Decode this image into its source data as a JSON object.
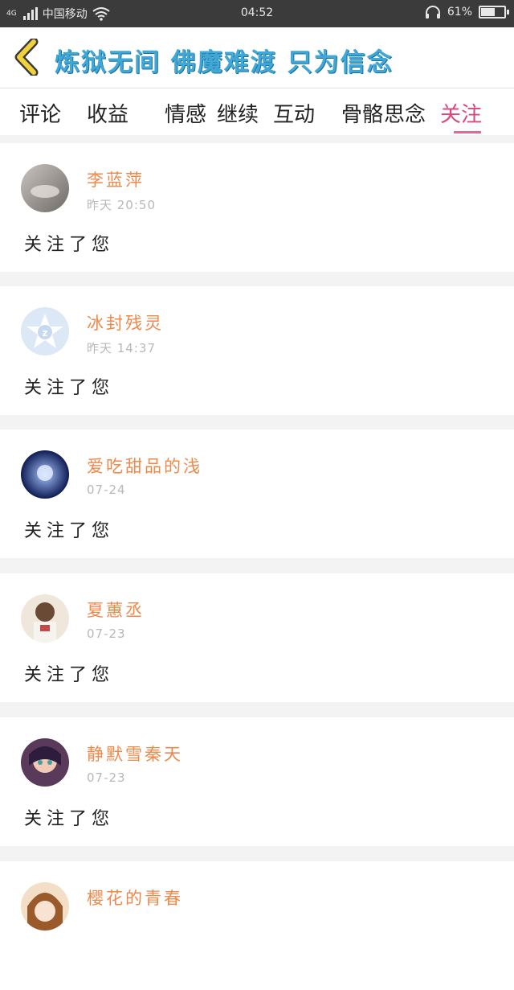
{
  "status_bar": {
    "network": "4G",
    "carrier": "中国移动",
    "time": "04:52",
    "battery": "61%",
    "battery_level": 0.61,
    "icons": [
      "signal-icon",
      "wifi-icon",
      "headphone-icon",
      "battery-icon"
    ]
  },
  "header": {
    "back_icon": "chevron-left-icon",
    "title": "炼狱无间 佛魔难渡 只为信念"
  },
  "tabs": [
    {
      "label": "评论"
    },
    {
      "label": "收益"
    },
    {
      "label": "情感"
    },
    {
      "label": "继续"
    },
    {
      "label": "互动"
    },
    {
      "label": "骨骼"
    },
    {
      "label": "思念"
    },
    {
      "label": "关注"
    }
  ],
  "active_tab": "关注",
  "colors": {
    "title": "#3fa8d8",
    "name": "#f0884a",
    "active_tab_underline": "#e06a9a",
    "time": "#b8b8b8"
  },
  "notifications": [
    {
      "name": "李蓝萍",
      "time": "昨天 20:50",
      "action": "关注了您"
    },
    {
      "name": "冰封残灵",
      "time": "昨天 14:37",
      "action": "关注了您"
    },
    {
      "name": "爱吃甜品的浅",
      "time": "07-24",
      "action": "关注了您"
    },
    {
      "name": "夏蕙丞",
      "time": "07-23",
      "action": "关注了您"
    },
    {
      "name": "静默雪秦天",
      "time": "07-23",
      "action": "关注了您"
    },
    {
      "name": "樱花的青春",
      "time": "",
      "action": ""
    }
  ]
}
